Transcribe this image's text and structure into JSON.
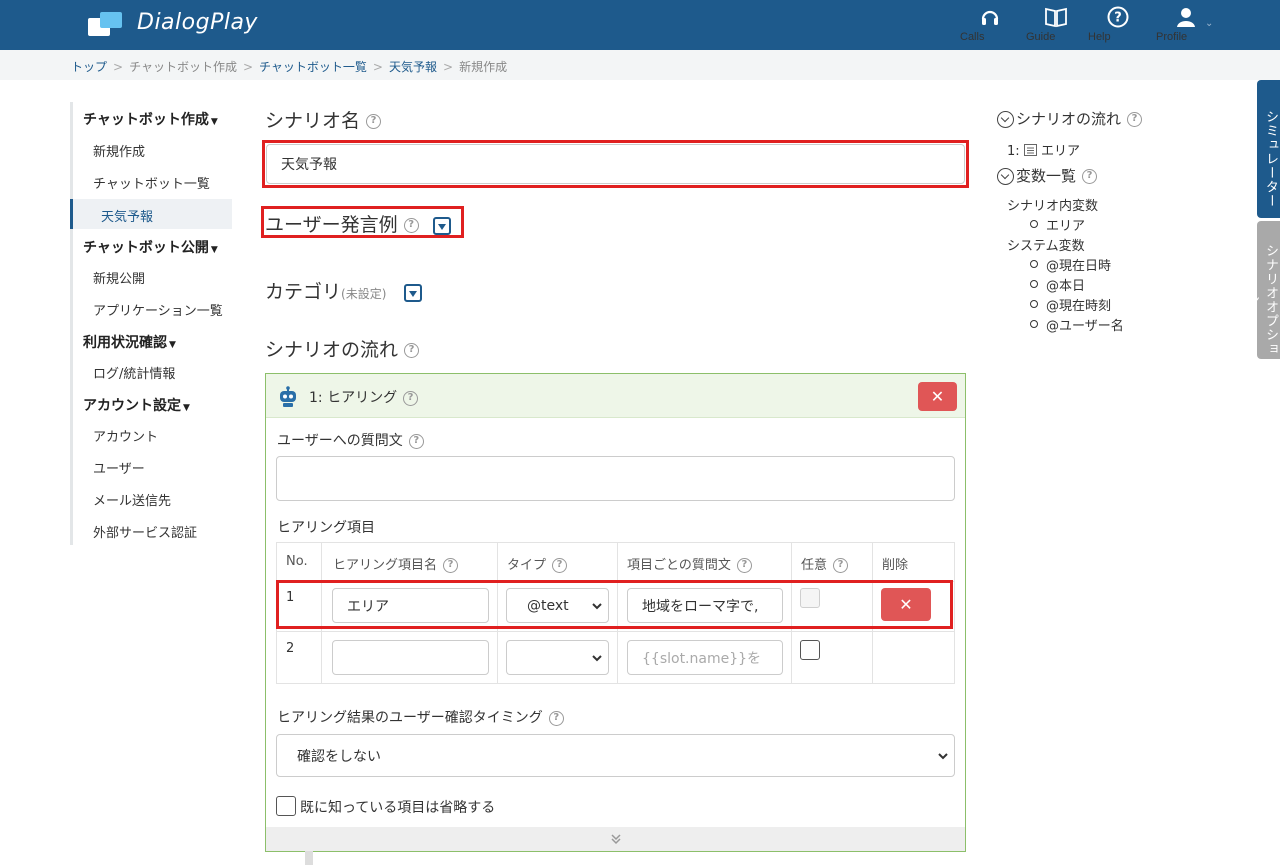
{
  "header": {
    "brand": "DialogPlay",
    "nav": [
      {
        "label": "Calls",
        "icon": "headset-icon"
      },
      {
        "label": "Guide",
        "icon": "book-icon"
      },
      {
        "label": "Help",
        "icon": "help-icon"
      },
      {
        "label": "Profile",
        "icon": "user-icon"
      }
    ]
  },
  "breadcrumb": [
    "トップ",
    "チャットボット作成",
    "チャットボット一覧",
    "天気予報",
    "新規作成"
  ],
  "sidebar": {
    "sections": [
      {
        "title": "チャットボット作成",
        "items": [
          "新規作成",
          "チャットボット一覧",
          "天気予報"
        ]
      },
      {
        "title": "チャットボット公開",
        "items": [
          "新規公開",
          "アプリケーション一覧"
        ]
      },
      {
        "title": "利用状況確認",
        "items": [
          "ログ/統計情報"
        ]
      },
      {
        "title": "アカウント設定",
        "items": [
          "アカウント",
          "ユーザー",
          "メール送信先",
          "外部サービス認証"
        ]
      }
    ],
    "active": "天気予報"
  },
  "main": {
    "scenario_name_label": "シナリオ名",
    "scenario_name_value": "天気予報",
    "user_utterance_label": "ユーザー発言例",
    "category_label": "カテゴリ",
    "category_note": "(未設定)",
    "flow_label": "シナリオの流れ",
    "panel": {
      "title": "1: ヒアリング",
      "question_label": "ユーザーへの質問文",
      "question_value": "",
      "items_label": "ヒアリング項目",
      "columns": [
        "No.",
        "ヒアリング項目名",
        "タイプ",
        "項目ごとの質問文",
        "任意",
        "削除"
      ],
      "rows": [
        {
          "no": "1",
          "name": "エリア",
          "type": "@text",
          "question": "地域をローマ字で,",
          "optional": false
        },
        {
          "no": "2",
          "name": "",
          "type": "",
          "question_placeholder": "{{slot.name}}を",
          "optional": false
        }
      ],
      "confirm_label": "ヒアリング結果のユーザー確認タイミング",
      "confirm_value": "確認をしない",
      "skip_known_label": "既に知っている項目は省略する",
      "delete_symbol": "✕"
    }
  },
  "right": {
    "flow_title": "シナリオの流れ",
    "flow_item": "1: ",
    "flow_item_name": "エリア",
    "vars_title": "変数一覧",
    "scenario_vars_label": "シナリオ内変数",
    "scenario_vars": [
      "エリア"
    ],
    "system_vars_label": "システム変数",
    "system_vars": [
      "@現在日時",
      "@本日",
      "@現在時刻",
      "@ユーザー名"
    ]
  },
  "side_tabs": [
    "シミュレーター",
    "シナリオオプション"
  ],
  "colors": {
    "header": "#1e5a8c",
    "highlight": "#e02020",
    "delete": "#e05656",
    "panel_border": "#8cbf6a"
  }
}
